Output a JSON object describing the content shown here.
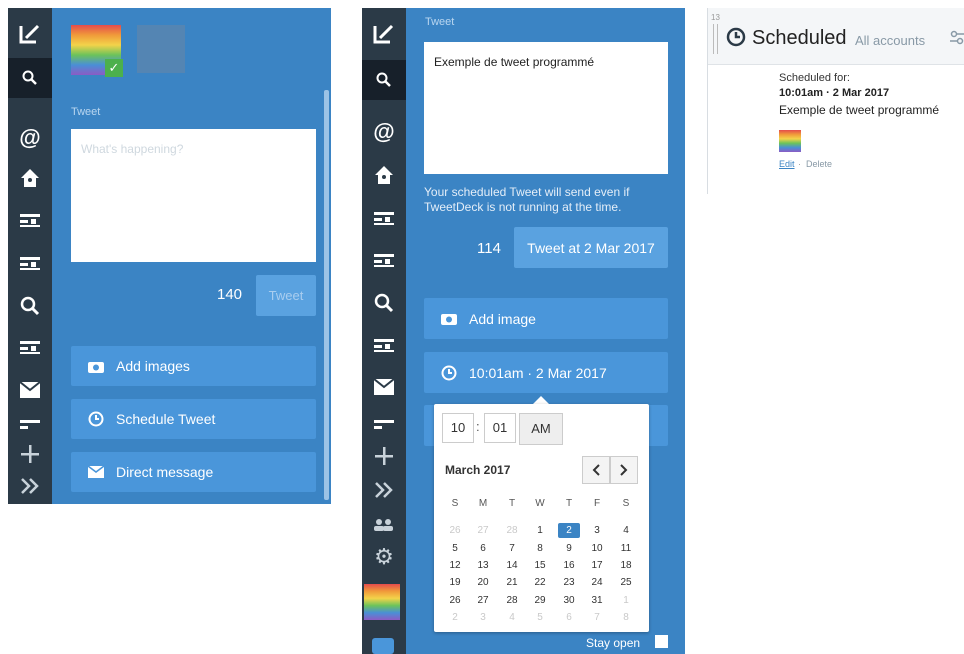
{
  "left": {
    "tweet_label": "Tweet",
    "placeholder": "What's happening?",
    "char_count": "140",
    "tweet_button": "Tweet",
    "buttons": {
      "add_images": "Add images",
      "schedule": "Schedule Tweet",
      "dm": "Direct message"
    }
  },
  "middle": {
    "tweet_label": "Tweet",
    "tweet_text": "Exemple de tweet programmé",
    "notice": "Your scheduled Tweet will send even if TweetDeck is not running at the time.",
    "char_count": "114",
    "tweet_button": "Tweet at 2 Mar 2017",
    "add_image": "Add image",
    "schedule_value": "10:01am · 2 Mar 2017",
    "stay_open": "Stay open"
  },
  "picker": {
    "hour": "10",
    "sep": ":",
    "minute": "01",
    "ampm": "AM",
    "month": "March 2017",
    "weekdays": [
      "S",
      "M",
      "T",
      "W",
      "T",
      "F",
      "S"
    ],
    "days": [
      [
        "26",
        "27",
        "28",
        "1",
        "2",
        "3",
        "4"
      ],
      [
        "5",
        "6",
        "7",
        "8",
        "9",
        "10",
        "11"
      ],
      [
        "12",
        "13",
        "14",
        "15",
        "16",
        "17",
        "18"
      ],
      [
        "19",
        "20",
        "21",
        "22",
        "23",
        "24",
        "25"
      ],
      [
        "26",
        "27",
        "28",
        "29",
        "30",
        "31",
        "1"
      ],
      [
        "2",
        "3",
        "4",
        "5",
        "6",
        "7",
        "8"
      ]
    ]
  },
  "right": {
    "column_number": "13",
    "title": "Scheduled",
    "subtitle": "All accounts",
    "scheduled_for": "Scheduled for:",
    "time": "10:01am · 2 Mar 2017",
    "text": "Exemple de tweet programmé",
    "edit": "Edit",
    "sep": "·",
    "delete": "Delete"
  },
  "colors": {
    "panel": "#3b84c4",
    "sidebar": "#2b3a47",
    "button": "#4a96da",
    "selected_day": "#3b84c4"
  }
}
